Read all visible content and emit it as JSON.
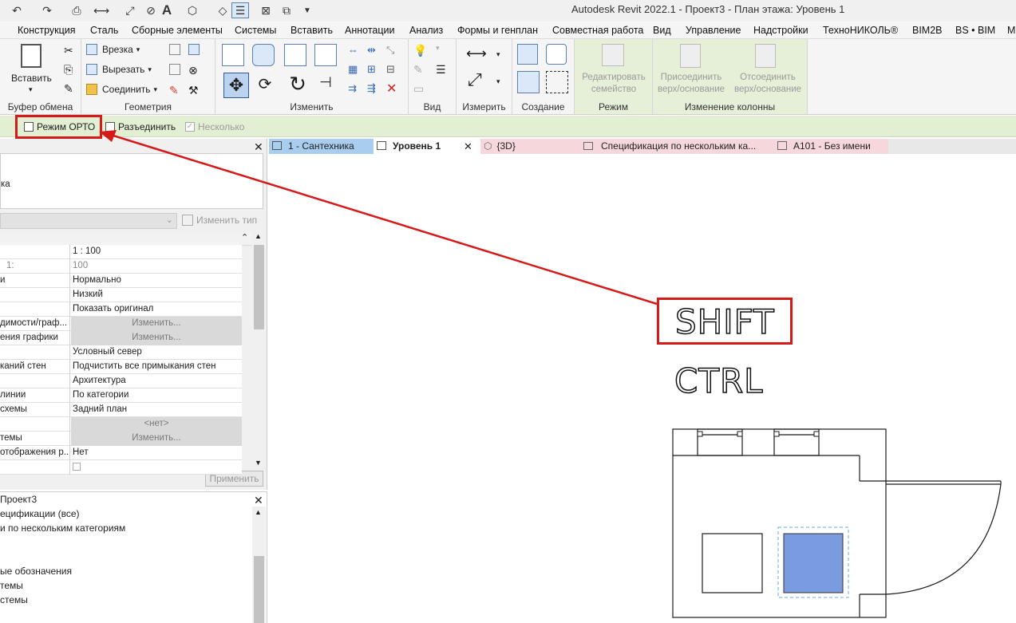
{
  "window": {
    "title": "Autodesk Revit 2022.1 - Проект3 - План этажа: Уровень 1"
  },
  "menu": [
    "Конструкция",
    "Сталь",
    "Сборные элементы",
    "Системы",
    "Вставить",
    "Аннотации",
    "Анализ",
    "Формы и генплан",
    "Совместная работа",
    "Вид",
    "Управление",
    "Надстройки",
    "ТехноНИКОЛЬ®",
    "BIM2B",
    "BS • BIM",
    "M"
  ],
  "ribbon": {
    "clipboard": {
      "title": "Буфер обмена",
      "paste": "Вставить"
    },
    "geometry": {
      "title": "Геометрия",
      "cut": "Врезка",
      "cut_out": "Вырезать",
      "join": "Соединить"
    },
    "modify": {
      "title": "Изменить"
    },
    "view": {
      "title": "Вид"
    },
    "measure": {
      "title": "Измерить"
    },
    "create": {
      "title": "Создание"
    },
    "mode": {
      "title": "Режим",
      "edit_family_1": "Редактировать",
      "edit_family_2": "семейство"
    },
    "column": {
      "title": "Изменение колонны",
      "attach_1": "Присоединить",
      "attach_2": "верх/основание",
      "detach_1": "Отсоединить",
      "detach_2": "верх/основание"
    }
  },
  "options_bar": {
    "ortho": "Режим ОРТО",
    "disjoin": "Разъединить",
    "multiple": "Несколько"
  },
  "properties": {
    "fragment": "ка",
    "edit_type": "Изменить тип",
    "apply": "Применить",
    "rows": [
      {
        "k": "",
        "v": "1 : 100"
      },
      {
        "k": "1:",
        "v": "100"
      },
      {
        "k": "и",
        "v": "Нормально"
      },
      {
        "k": "",
        "v": "Низкий"
      },
      {
        "k": "",
        "v": "Показать оригинал"
      },
      {
        "k": "димости/граф...",
        "v": "Изменить..."
      },
      {
        "k": "ения графики",
        "v": "Изменить..."
      },
      {
        "k": "",
        "v": "Условный север"
      },
      {
        "k": "каний стен",
        "v": "Подчистить все примыкания стен"
      },
      {
        "k": "",
        "v": "Архитектура"
      },
      {
        "k": "линии",
        "v": "По категории"
      },
      {
        "k": "схемы",
        "v": "Задний план"
      },
      {
        "k": "",
        "v": "<нет>"
      },
      {
        "k": "темы",
        "v": "Изменить..."
      },
      {
        "k": "отображения р...",
        "v": "Нет"
      }
    ]
  },
  "project_browser": {
    "title": "Проект3",
    "items": [
      "ецификации (все)",
      "и по нескольким категориям",
      "ые обозначения",
      "темы",
      "стемы"
    ]
  },
  "tabs": [
    {
      "label": "1 - Сантехника",
      "color": "#a9cdef"
    },
    {
      "label": "Уровень 1",
      "color": "#ffffff"
    },
    {
      "label": "{3D}",
      "color": "#f6d8dc"
    },
    {
      "label": "Спецификация по нескольким ка...",
      "color": "#f6d8dc"
    },
    {
      "label": "A101 - Без имени",
      "color": "#f6d8dc"
    }
  ],
  "canvas": {
    "shift_label": "SHIFT",
    "ctrl_label": "CTRL"
  },
  "colors": {
    "annotation": "#d61a1a",
    "selected_fill": "#7b9be0",
    "ribbon_green": "#e3efd3"
  }
}
